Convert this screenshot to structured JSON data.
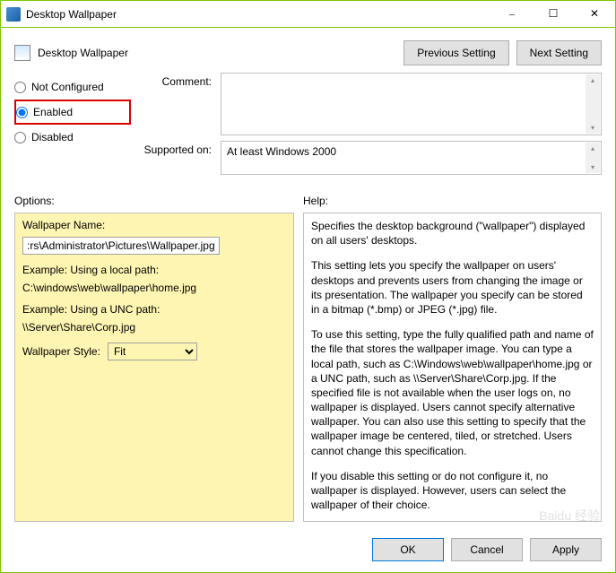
{
  "window": {
    "title": "Desktop Wallpaper",
    "minimize": "–",
    "maximize": "☐",
    "close": "✕"
  },
  "header": {
    "title": "Desktop Wallpaper",
    "previous": "Previous Setting",
    "next": "Next Setting"
  },
  "radios": {
    "not_configured": "Not Configured",
    "enabled": "Enabled",
    "disabled": "Disabled"
  },
  "labels": {
    "comment": "Comment:",
    "supported": "Supported on:",
    "options": "Options:",
    "help": "Help:"
  },
  "supported_text": "At least Windows 2000",
  "options": {
    "wallpaper_name_label": "Wallpaper Name:",
    "wallpaper_name_value": ":rs\\Administrator\\Pictures\\Wallpaper.jpg",
    "example1_label": "Example: Using a local path:",
    "example1_value": "C:\\windows\\web\\wallpaper\\home.jpg",
    "example2_label": "Example: Using a UNC path:",
    "example2_value": "\\\\Server\\Share\\Corp.jpg",
    "style_label": "Wallpaper Style:",
    "style_value": "Fit"
  },
  "help": {
    "p1": "Specifies the desktop background (\"wallpaper\") displayed on all users' desktops.",
    "p2": "This setting lets you specify the wallpaper on users' desktops and prevents users from changing the image or its presentation. The wallpaper you specify can be stored in a bitmap (*.bmp) or JPEG (*.jpg) file.",
    "p3": "To use this setting, type the fully qualified path and name of the file that stores the wallpaper image. You can type a local path, such as C:\\Windows\\web\\wallpaper\\home.jpg or a UNC path, such as \\\\Server\\Share\\Corp.jpg. If the specified file is not available when the user logs on, no wallpaper is displayed. Users cannot specify alternative wallpaper. You can also use this setting to specify that the wallpaper image be centered, tiled, or stretched. Users cannot change this specification.",
    "p4": "If you disable this setting or do not configure it, no wallpaper is displayed. However, users can select the wallpaper of their choice."
  },
  "footer": {
    "ok": "OK",
    "cancel": "Cancel",
    "apply": "Apply"
  },
  "watermark": "Baidu 经验"
}
